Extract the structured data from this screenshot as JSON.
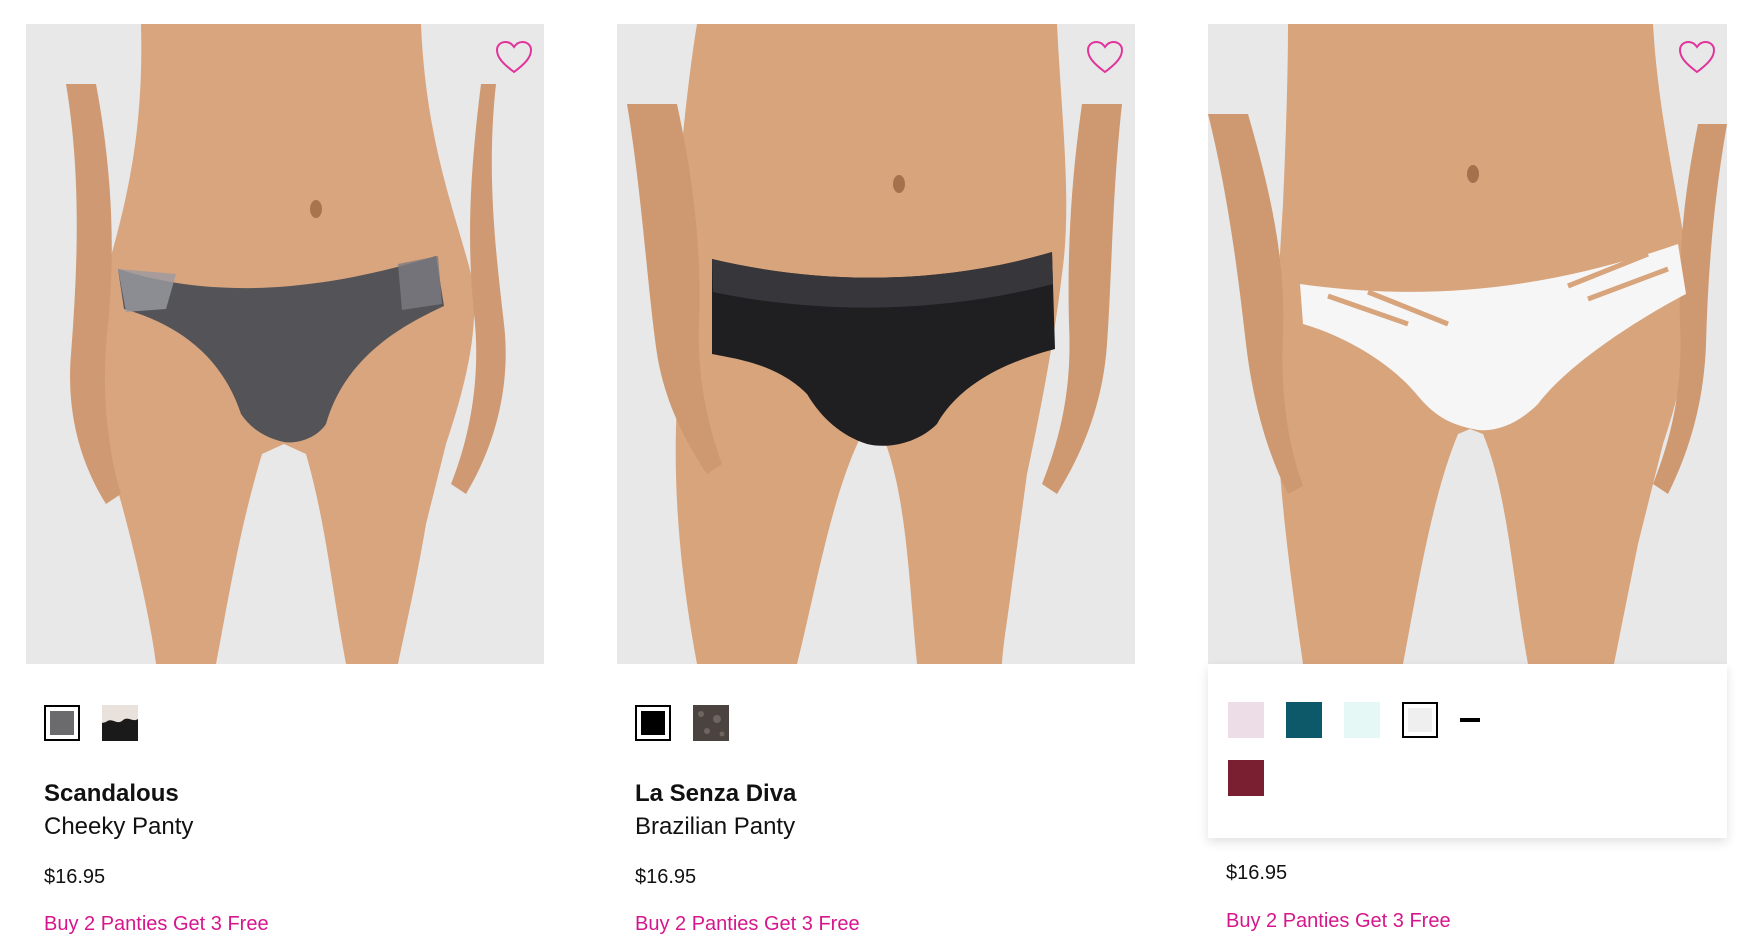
{
  "colors": {
    "accent_pink": "#d6168c",
    "image_bg": "#e8e8e8",
    "text": "#111111"
  },
  "products": [
    {
      "title": "Scandalous",
      "subtitle": "Cheeky Panty",
      "price": "$16.95",
      "promo": "Buy 2 Panties Get 3 Free",
      "wishlist_icon": "heart-outline-icon",
      "swatches": [
        {
          "color": "#6b6b6e",
          "selected": true
        },
        {
          "color": "#1a1a1a",
          "accent": "#e9e2dc",
          "selected": false
        }
      ]
    },
    {
      "title": "La Senza Diva",
      "subtitle": "Brazilian Panty",
      "price": "$16.95",
      "promo": "Buy 2 Panties Get 3 Free",
      "wishlist_icon": "heart-outline-icon",
      "swatches": [
        {
          "color": "#000000",
          "selected": true
        },
        {
          "color": "#4a4340",
          "selected": false
        }
      ]
    },
    {
      "title": "",
      "subtitle": "",
      "price": "$16.95",
      "promo": "Buy 2 Panties Get 3 Free",
      "wishlist_icon": "heart-outline-icon",
      "more_indicator": "minus-icon",
      "swatches": [
        {
          "color": "#ecdde6",
          "selected": false
        },
        {
          "color": "#0d5869",
          "selected": false
        },
        {
          "color": "#e6f8f5",
          "selected": false
        },
        {
          "color": "#efefef",
          "selected": true
        },
        {
          "color": "#7a1f31",
          "selected": false
        }
      ]
    }
  ]
}
